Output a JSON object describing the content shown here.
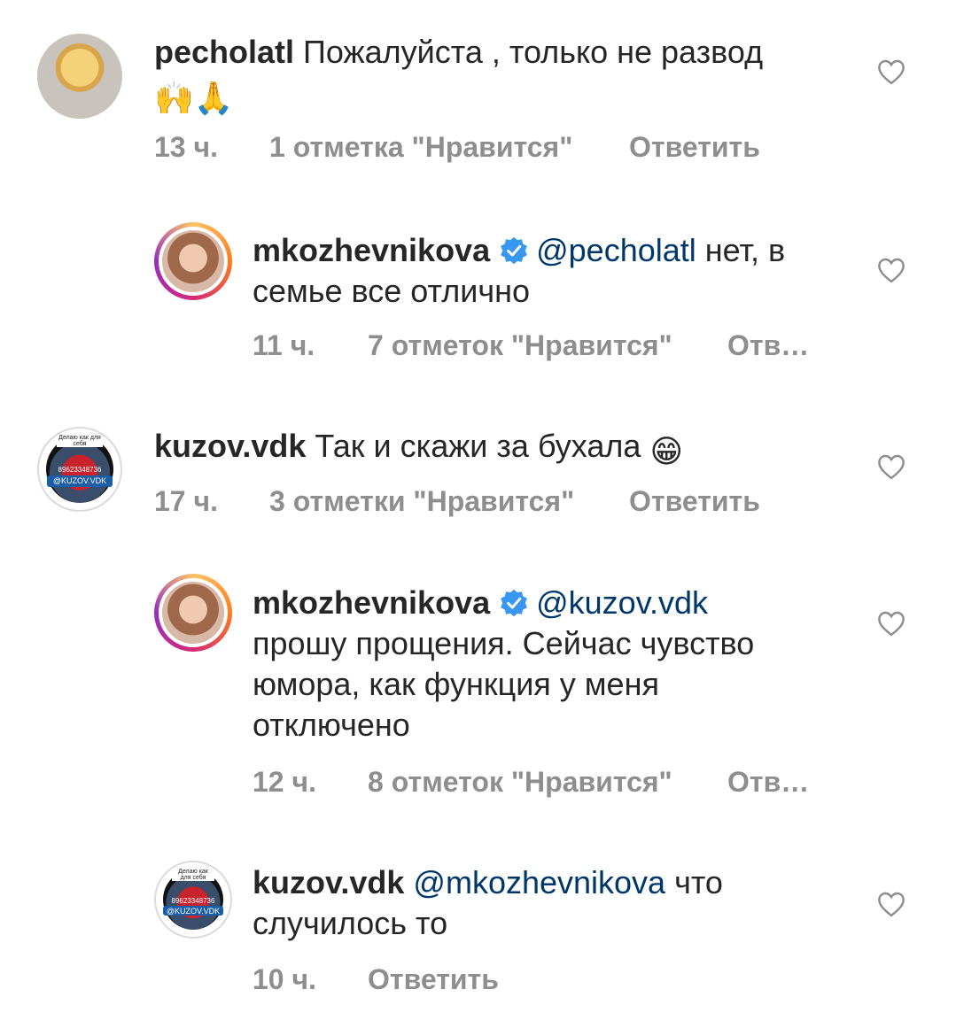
{
  "comments": [
    {
      "username": "pecholatl",
      "text": "Пожалуйста , только не развод",
      "emoji_line": "🙌🙏",
      "time": "13 ч.",
      "likes": "1 отметка \"Нравится\"",
      "reply": "Ответить"
    },
    {
      "username": "mkozhevnikova",
      "mention": "@pecholatl",
      "text_line1": " нет, в",
      "text_line2": "семье все отлично",
      "time": "11 ч.",
      "likes": "7 отметок \"Нравится\"",
      "reply": "Отв…"
    },
    {
      "username": "kuzov.vdk",
      "text": "Так и скажи за бухала",
      "emoji": "😁",
      "time": "17 ч.",
      "likes": "3 отметки \"Нравится\"",
      "reply": "Ответить"
    },
    {
      "username": "mkozhevnikova",
      "mention": "@kuzov.vdk",
      "text_line2": "прошу прощения. Сейчас чувство",
      "text_line3": "юмора, как функция у меня",
      "text_line4": "отключено",
      "time": "12 ч.",
      "likes": "8 отметок \"Нравится\"",
      "reply": "Отв…"
    },
    {
      "username": "kuzov.vdk",
      "mention": "@mkozhevnikova",
      "text_line1": " что",
      "text_line2": "случилось то",
      "time": "10 ч.",
      "reply": "Ответить"
    }
  ],
  "avatar_text": {
    "top": "Делаю как для себя",
    "phone": "89623348736",
    "tag": "@KUZOV.VDK"
  },
  "colors": {
    "text": "#262626",
    "meta": "#8e8e8e",
    "mention": "#00376b",
    "verified": "#3897f0"
  }
}
